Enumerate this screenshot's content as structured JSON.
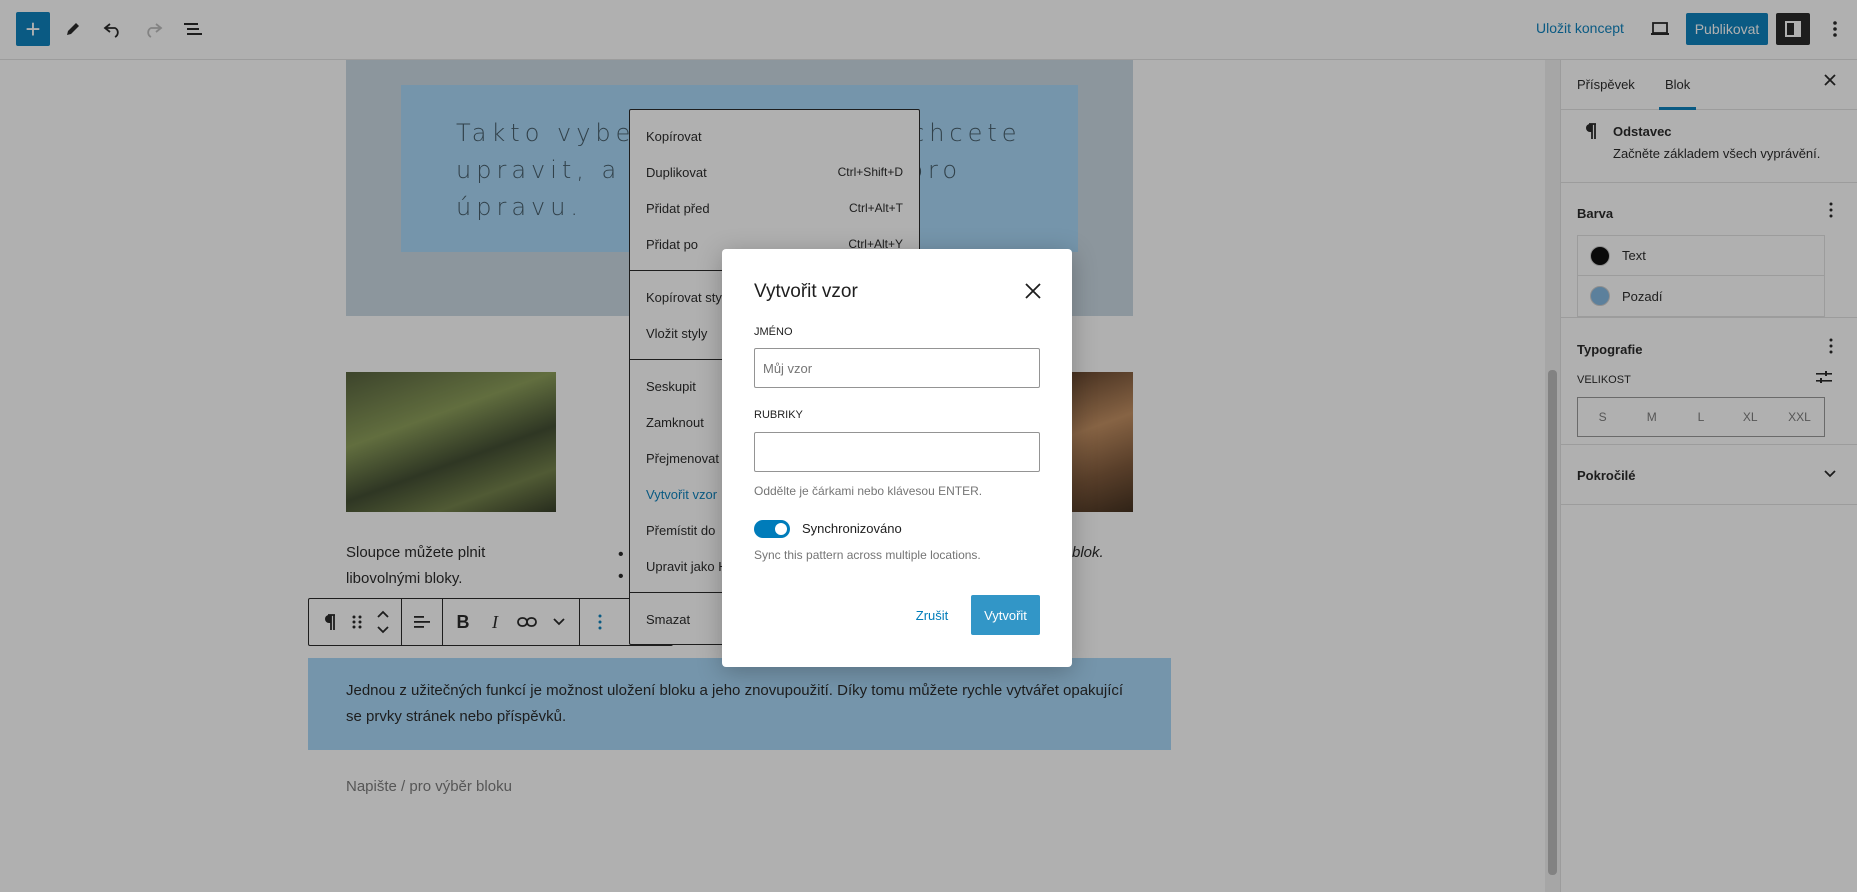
{
  "toolbar": {
    "add": "+",
    "save_draft": "Uložit koncept",
    "publish": "Publikovat"
  },
  "cover": {
    "text": "Takto vyberte bloky, které chcete upravit, a otevře se panel pro úpravu."
  },
  "columns": {
    "left_text": "Sloupce můžete plnit libovolnými bloky.",
    "bullets": [
      "•",
      "•"
    ],
    "right_text": "blok."
  },
  "paragraph": {
    "text": "Jednou z užitečných funkcí je možnost uložení bloku a jeho znovupoužití. Díky tomu můžete rychle vytvářet opakující se prvky stránek nebo příspěvků."
  },
  "placeholder": "Napište / pro výběr bloku",
  "context_menu": {
    "groups": [
      [
        {
          "label": "Kopírovat",
          "shortcut": ""
        },
        {
          "label": "Duplikovat",
          "shortcut": "Ctrl+Shift+D"
        },
        {
          "label": "Přidat před",
          "shortcut": "Ctrl+Alt+T"
        },
        {
          "label": "Přidat po",
          "shortcut": "Ctrl+Alt+Y"
        }
      ],
      [
        {
          "label": "Kopírovat styly",
          "shortcut": ""
        },
        {
          "label": "Vložit styly",
          "shortcut": ""
        }
      ],
      [
        {
          "label": "Seskupit",
          "shortcut": ""
        },
        {
          "label": "Zamknout",
          "shortcut": ""
        },
        {
          "label": "Přejmenovat",
          "shortcut": ""
        },
        {
          "label": "Vytvořit vzor",
          "shortcut": ""
        },
        {
          "label": "Přemístit do",
          "shortcut": ""
        },
        {
          "label": "Upravit jako HTML",
          "shortcut": ""
        }
      ],
      [
        {
          "label": "Smazat",
          "shortcut": ""
        }
      ]
    ]
  },
  "sidebar": {
    "tabs": [
      "Příspěvek",
      "Blok"
    ],
    "block_name": "Odstavec",
    "block_desc": "Začněte základem všech vyprávění.",
    "color_title": "Barva",
    "colors": [
      {
        "label": "Text",
        "swatch": "#000000"
      },
      {
        "label": "Pozadí",
        "swatch": "#7eb6e0"
      }
    ],
    "typography_title": "Typografie",
    "size_label": "VELIKOST",
    "sizes": [
      "S",
      "M",
      "L",
      "XL",
      "XXL"
    ],
    "advanced_title": "Pokročilé"
  },
  "modal": {
    "title": "Vytvořit vzor",
    "name_label": "JMÉNO",
    "name_placeholder": "Můj vzor",
    "categories_label": "RUBRIKY",
    "categories_help": "Oddělte je čárkami nebo klávesou ENTER.",
    "sync_label": "Synchronizováno",
    "sync_help": "Sync this pattern across multiple locations.",
    "cancel": "Zrušit",
    "create": "Vytvořit"
  },
  "colors": {
    "accent": "#007cba",
    "block_bg": "#a5d6f7"
  }
}
